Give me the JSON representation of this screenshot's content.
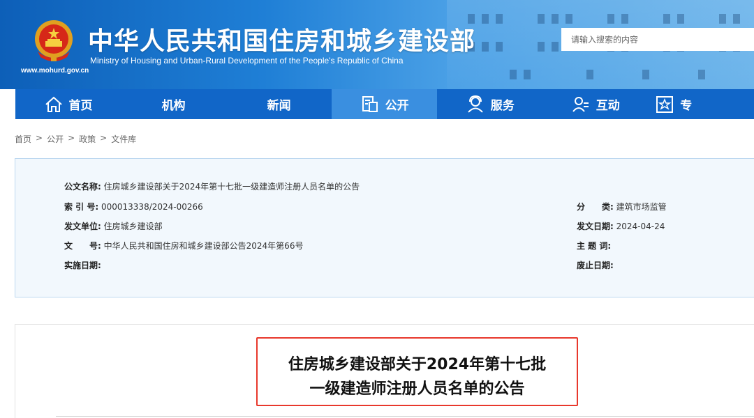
{
  "header": {
    "title": "中华人民共和国住房和城乡建设部",
    "subtitle": "Ministry of Housing and Urban-Rural Development of the People's Republic of China",
    "url": "www.mohurd.gov.cn",
    "search_placeholder": "请输入搜索的内容"
  },
  "nav": {
    "items": [
      {
        "label": "首页",
        "icon": "home-icon"
      },
      {
        "label": "机构",
        "icon": ""
      },
      {
        "label": "新闻",
        "icon": ""
      },
      {
        "label": "公开",
        "icon": "document-icon",
        "active": true
      },
      {
        "label": "服务",
        "icon": "service-icon"
      },
      {
        "label": "互动",
        "icon": "interact-icon"
      },
      {
        "label": "专",
        "icon": "star-icon"
      }
    ]
  },
  "breadcrumb": {
    "items": [
      "首页",
      "公开",
      "政策",
      "文件库"
    ],
    "separator": ">"
  },
  "info": {
    "doc_name_label": "公文名称:",
    "doc_name": "住房城乡建设部关于2024年第十七批一级建造师注册人员名单的公告",
    "index_label": "索 引 号:",
    "index": "000013338/2024-00266",
    "category_label": "分　　类:",
    "category": "建筑市场监管",
    "issuer_label": "发文单位:",
    "issuer": "住房城乡建设部",
    "date_label": "发文日期:",
    "date": "2024-04-24",
    "doc_no_label": "文　　号:",
    "doc_no": "中华人民共和国住房和城乡建设部公告2024年第66号",
    "subject_label": "主 题 词:",
    "subject": "",
    "effective_label": "实施日期:",
    "effective": "",
    "repeal_label": "废止日期:",
    "repeal": ""
  },
  "article": {
    "title_line1": "住房城乡建设部关于2024年第十七批",
    "title_line2": "一级建造师注册人员名单的公告"
  },
  "colors": {
    "header_blue": "#1166c8",
    "nav_active": "#3a8fe0",
    "highlight_red": "#e8382c",
    "panel_bg": "#f2f8fd"
  }
}
